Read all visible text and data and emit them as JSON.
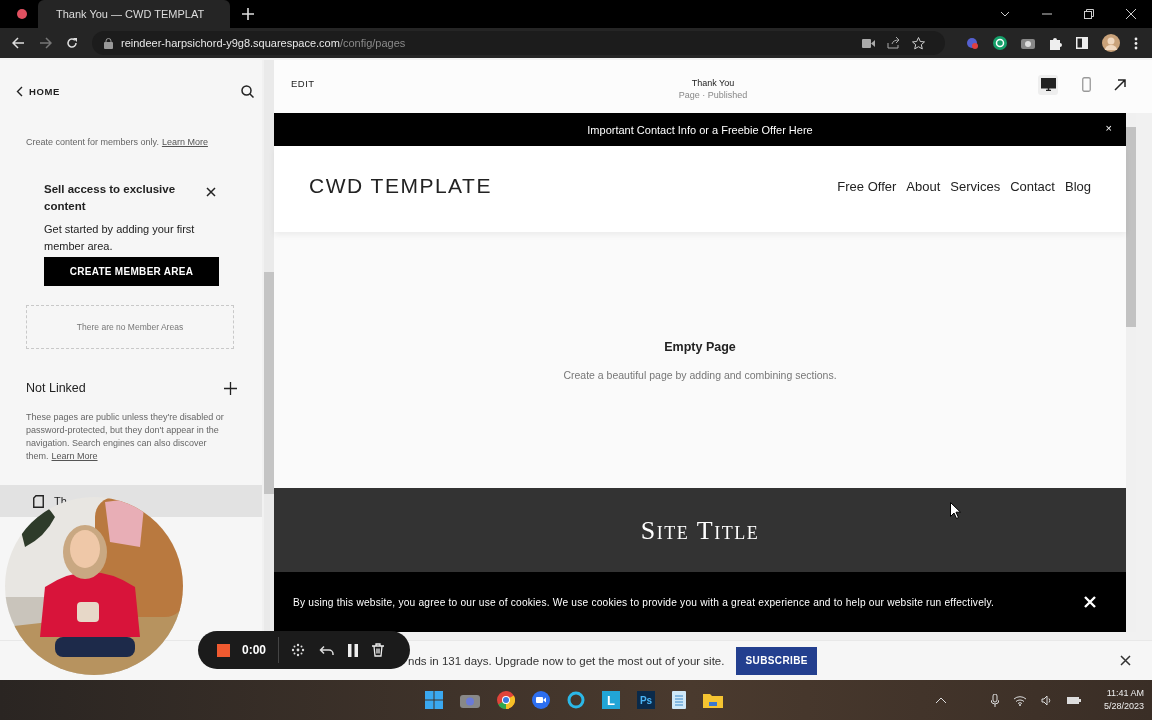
{
  "browser": {
    "tab_title": "Thank You — CWD TEMPLAT",
    "url_host": "reindeer-harpsichord-y9g8.squarespace.com",
    "url_path": "/config/pages"
  },
  "sidebar": {
    "back": "HOME",
    "members_note": {
      "text": "Create content for members only.",
      "link": "Learn More"
    },
    "promo": {
      "title": "Sell access to exclusive content",
      "body": "Get started by adding your first member area.",
      "button": "CREATE MEMBER AREA"
    },
    "empty_note": "There are no Member Areas",
    "not_linked": {
      "heading": "Not Linked",
      "text": "These pages are public unless they're disabled or password-protected, but they don't appear in the navigation. Search engines can also discover them.",
      "link": "Learn More"
    },
    "pages": [
      {
        "label": "Th",
        "selected": true
      }
    ]
  },
  "editor": {
    "edit": "EDIT",
    "page_title": "Thank You",
    "page_status": "Page · Published",
    "views": [
      {
        "kind": "desktop",
        "selected": true
      },
      {
        "kind": "mobile",
        "selected": false
      }
    ]
  },
  "site": {
    "announcement": "Important Contact Info or a Freebie Offer Here",
    "announcement_close": "×",
    "logo": "CWD TEMPLATE",
    "nav": [
      "Free Offer",
      "About",
      "Services",
      "Contact",
      "Blog"
    ],
    "empty_title": "Empty Page",
    "empty_text": "Create a beautiful page by adding and combining sections.",
    "footer_title": "Site Title",
    "cookie_text": "By using this website, you agree to our use of cookies. We use cookies to provide you with a great experience and to help our website run effectively."
  },
  "upgrade_banner": {
    "text": "nds in 131 days. Upgrade now to get the most out of your site.",
    "button": "SUBSCRIBE"
  },
  "recorder": {
    "time": "0:00"
  },
  "taskbar": {
    "apps": [
      {
        "kind": "windows"
      },
      {
        "kind": "camera"
      },
      {
        "kind": "chrome"
      },
      {
        "kind": "zoom"
      },
      {
        "kind": "cortana"
      },
      {
        "kind": "letter",
        "label": "L"
      },
      {
        "kind": "ps",
        "label": "Ps"
      },
      {
        "kind": "notepad"
      },
      {
        "kind": "folder"
      }
    ],
    "time": "11:41 AM",
    "date": "5/28/2023"
  }
}
